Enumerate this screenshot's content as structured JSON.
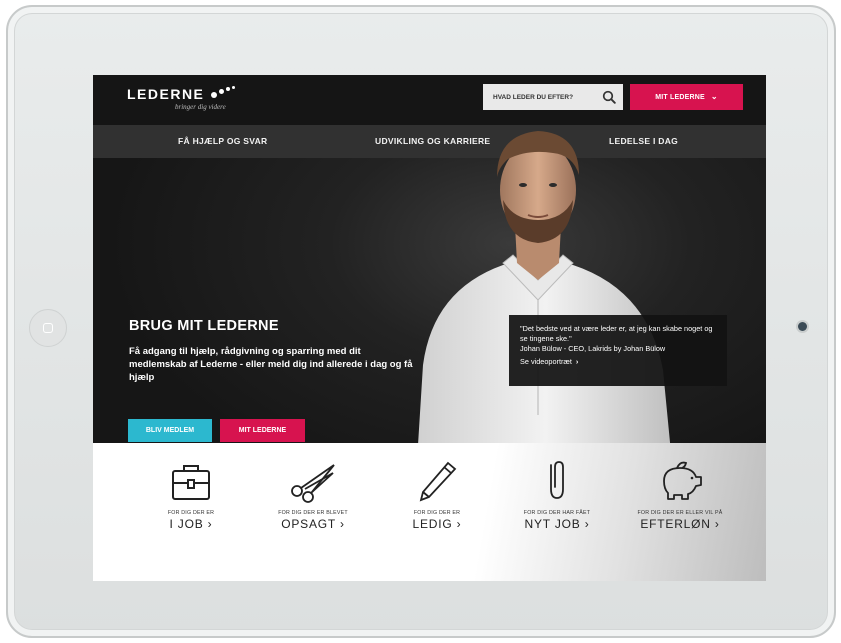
{
  "header": {
    "logo_text": "LEDERNE",
    "logo_tagline": "bringer dig videre",
    "search_placeholder": "HVAD LEDER DU EFTER?",
    "mit_button": "MIT LEDERNE"
  },
  "nav": {
    "items": [
      "FÅ HJÆLP OG SVAR",
      "UDVIKLING OG KARRIERE",
      "LEDELSE I DAG"
    ]
  },
  "hero": {
    "title": "BRUG MIT LEDERNE",
    "text": "Få adgang til hjælp, rådgivning og sparring med dit medlemskab af Lederne - eller meld dig ind allerede i dag og få hjælp",
    "btn_member": "BLIV MEDLEM",
    "btn_mit": "MIT LEDERNE"
  },
  "quote": {
    "text": "\"Det bedste ved at være leder er, at jeg kan skabe noget og se tingene ske.\"",
    "author": "Johan Bülow - CEO, Lakrids by Johan Bülow",
    "link": "Se videoportræt",
    "link_arrow": "›"
  },
  "categories": [
    {
      "icon": "briefcase-icon",
      "small": "FOR DIG DER ER",
      "big": "I JOB ›"
    },
    {
      "icon": "scissors-icon",
      "small": "FOR DIG DER ER BLEVET",
      "big": "OPSAGT ›"
    },
    {
      "icon": "pen-icon",
      "small": "FOR DIG DER ER",
      "big": "LEDIG ›"
    },
    {
      "icon": "paperclip-icon",
      "small": "FOR DIG DER HAR FÅET",
      "big": "NYT JOB ›"
    },
    {
      "icon": "piggy-bank-icon",
      "small": "FOR DIG DER ER ELLER VIL PÅ",
      "big": "EFTERLØN ›"
    }
  ],
  "colors": {
    "accent_red": "#d7134f",
    "accent_blue": "#2cb8cf",
    "dark": "#151515"
  }
}
